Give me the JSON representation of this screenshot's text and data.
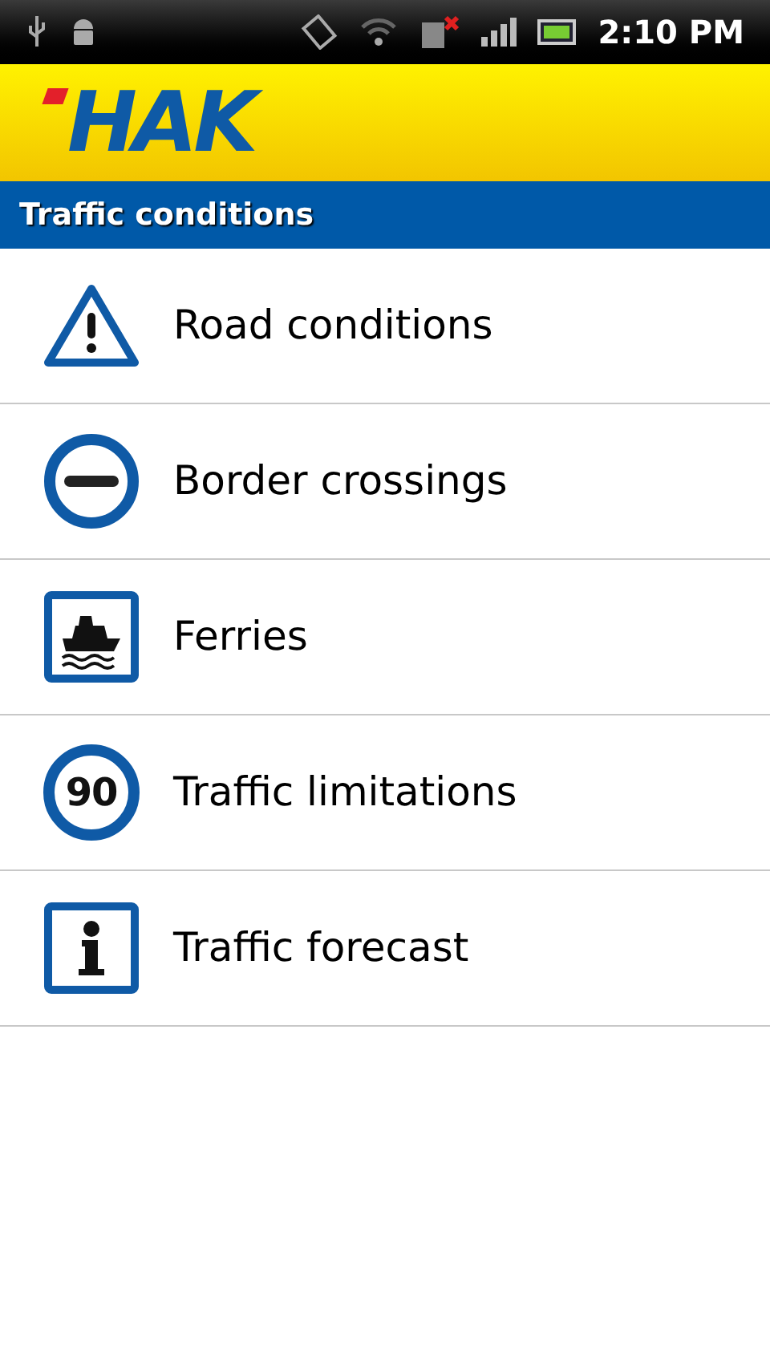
{
  "status_bar": {
    "time": "2:10 PM"
  },
  "header": {
    "logo": "HAK"
  },
  "title_bar": {
    "title": "Traffic conditions"
  },
  "menu": [
    {
      "kind": "warning",
      "label": "Road conditions"
    },
    {
      "kind": "no-entry",
      "label": "Border crossings"
    },
    {
      "kind": "ferry",
      "label": "Ferries"
    },
    {
      "kind": "speed",
      "sign_text": "90",
      "label": "Traffic limitations"
    },
    {
      "kind": "info",
      "label": "Traffic forecast"
    }
  ]
}
